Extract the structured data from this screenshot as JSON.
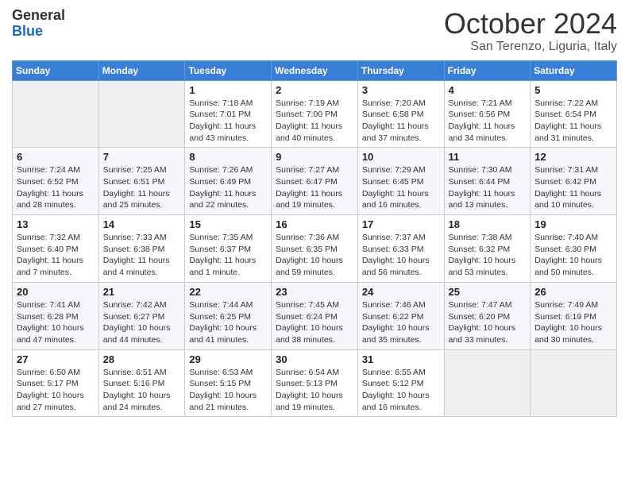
{
  "header": {
    "logo": {
      "general": "General",
      "blue": "Blue"
    },
    "title": "October 2024",
    "location": "San Terenzo, Liguria, Italy"
  },
  "days_of_week": [
    "Sunday",
    "Monday",
    "Tuesday",
    "Wednesday",
    "Thursday",
    "Friday",
    "Saturday"
  ],
  "weeks": [
    [
      {
        "day": null
      },
      {
        "day": null
      },
      {
        "day": "1",
        "sunrise": "Sunrise: 7:18 AM",
        "sunset": "Sunset: 7:01 PM",
        "daylight": "Daylight: 11 hours and 43 minutes."
      },
      {
        "day": "2",
        "sunrise": "Sunrise: 7:19 AM",
        "sunset": "Sunset: 7:00 PM",
        "daylight": "Daylight: 11 hours and 40 minutes."
      },
      {
        "day": "3",
        "sunrise": "Sunrise: 7:20 AM",
        "sunset": "Sunset: 6:58 PM",
        "daylight": "Daylight: 11 hours and 37 minutes."
      },
      {
        "day": "4",
        "sunrise": "Sunrise: 7:21 AM",
        "sunset": "Sunset: 6:56 PM",
        "daylight": "Daylight: 11 hours and 34 minutes."
      },
      {
        "day": "5",
        "sunrise": "Sunrise: 7:22 AM",
        "sunset": "Sunset: 6:54 PM",
        "daylight": "Daylight: 11 hours and 31 minutes."
      }
    ],
    [
      {
        "day": "6",
        "sunrise": "Sunrise: 7:24 AM",
        "sunset": "Sunset: 6:52 PM",
        "daylight": "Daylight: 11 hours and 28 minutes."
      },
      {
        "day": "7",
        "sunrise": "Sunrise: 7:25 AM",
        "sunset": "Sunset: 6:51 PM",
        "daylight": "Daylight: 11 hours and 25 minutes."
      },
      {
        "day": "8",
        "sunrise": "Sunrise: 7:26 AM",
        "sunset": "Sunset: 6:49 PM",
        "daylight": "Daylight: 11 hours and 22 minutes."
      },
      {
        "day": "9",
        "sunrise": "Sunrise: 7:27 AM",
        "sunset": "Sunset: 6:47 PM",
        "daylight": "Daylight: 11 hours and 19 minutes."
      },
      {
        "day": "10",
        "sunrise": "Sunrise: 7:29 AM",
        "sunset": "Sunset: 6:45 PM",
        "daylight": "Daylight: 11 hours and 16 minutes."
      },
      {
        "day": "11",
        "sunrise": "Sunrise: 7:30 AM",
        "sunset": "Sunset: 6:44 PM",
        "daylight": "Daylight: 11 hours and 13 minutes."
      },
      {
        "day": "12",
        "sunrise": "Sunrise: 7:31 AM",
        "sunset": "Sunset: 6:42 PM",
        "daylight": "Daylight: 11 hours and 10 minutes."
      }
    ],
    [
      {
        "day": "13",
        "sunrise": "Sunrise: 7:32 AM",
        "sunset": "Sunset: 6:40 PM",
        "daylight": "Daylight: 11 hours and 7 minutes."
      },
      {
        "day": "14",
        "sunrise": "Sunrise: 7:33 AM",
        "sunset": "Sunset: 6:38 PM",
        "daylight": "Daylight: 11 hours and 4 minutes."
      },
      {
        "day": "15",
        "sunrise": "Sunrise: 7:35 AM",
        "sunset": "Sunset: 6:37 PM",
        "daylight": "Daylight: 11 hours and 1 minute."
      },
      {
        "day": "16",
        "sunrise": "Sunrise: 7:36 AM",
        "sunset": "Sunset: 6:35 PM",
        "daylight": "Daylight: 10 hours and 59 minutes."
      },
      {
        "day": "17",
        "sunrise": "Sunrise: 7:37 AM",
        "sunset": "Sunset: 6:33 PM",
        "daylight": "Daylight: 10 hours and 56 minutes."
      },
      {
        "day": "18",
        "sunrise": "Sunrise: 7:38 AM",
        "sunset": "Sunset: 6:32 PM",
        "daylight": "Daylight: 10 hours and 53 minutes."
      },
      {
        "day": "19",
        "sunrise": "Sunrise: 7:40 AM",
        "sunset": "Sunset: 6:30 PM",
        "daylight": "Daylight: 10 hours and 50 minutes."
      }
    ],
    [
      {
        "day": "20",
        "sunrise": "Sunrise: 7:41 AM",
        "sunset": "Sunset: 6:28 PM",
        "daylight": "Daylight: 10 hours and 47 minutes."
      },
      {
        "day": "21",
        "sunrise": "Sunrise: 7:42 AM",
        "sunset": "Sunset: 6:27 PM",
        "daylight": "Daylight: 10 hours and 44 minutes."
      },
      {
        "day": "22",
        "sunrise": "Sunrise: 7:44 AM",
        "sunset": "Sunset: 6:25 PM",
        "daylight": "Daylight: 10 hours and 41 minutes."
      },
      {
        "day": "23",
        "sunrise": "Sunrise: 7:45 AM",
        "sunset": "Sunset: 6:24 PM",
        "daylight": "Daylight: 10 hours and 38 minutes."
      },
      {
        "day": "24",
        "sunrise": "Sunrise: 7:46 AM",
        "sunset": "Sunset: 6:22 PM",
        "daylight": "Daylight: 10 hours and 35 minutes."
      },
      {
        "day": "25",
        "sunrise": "Sunrise: 7:47 AM",
        "sunset": "Sunset: 6:20 PM",
        "daylight": "Daylight: 10 hours and 33 minutes."
      },
      {
        "day": "26",
        "sunrise": "Sunrise: 7:49 AM",
        "sunset": "Sunset: 6:19 PM",
        "daylight": "Daylight: 10 hours and 30 minutes."
      }
    ],
    [
      {
        "day": "27",
        "sunrise": "Sunrise: 6:50 AM",
        "sunset": "Sunset: 5:17 PM",
        "daylight": "Daylight: 10 hours and 27 minutes."
      },
      {
        "day": "28",
        "sunrise": "Sunrise: 6:51 AM",
        "sunset": "Sunset: 5:16 PM",
        "daylight": "Daylight: 10 hours and 24 minutes."
      },
      {
        "day": "29",
        "sunrise": "Sunrise: 6:53 AM",
        "sunset": "Sunset: 5:15 PM",
        "daylight": "Daylight: 10 hours and 21 minutes."
      },
      {
        "day": "30",
        "sunrise": "Sunrise: 6:54 AM",
        "sunset": "Sunset: 5:13 PM",
        "daylight": "Daylight: 10 hours and 19 minutes."
      },
      {
        "day": "31",
        "sunrise": "Sunrise: 6:55 AM",
        "sunset": "Sunset: 5:12 PM",
        "daylight": "Daylight: 10 hours and 16 minutes."
      },
      {
        "day": null
      },
      {
        "day": null
      }
    ]
  ]
}
